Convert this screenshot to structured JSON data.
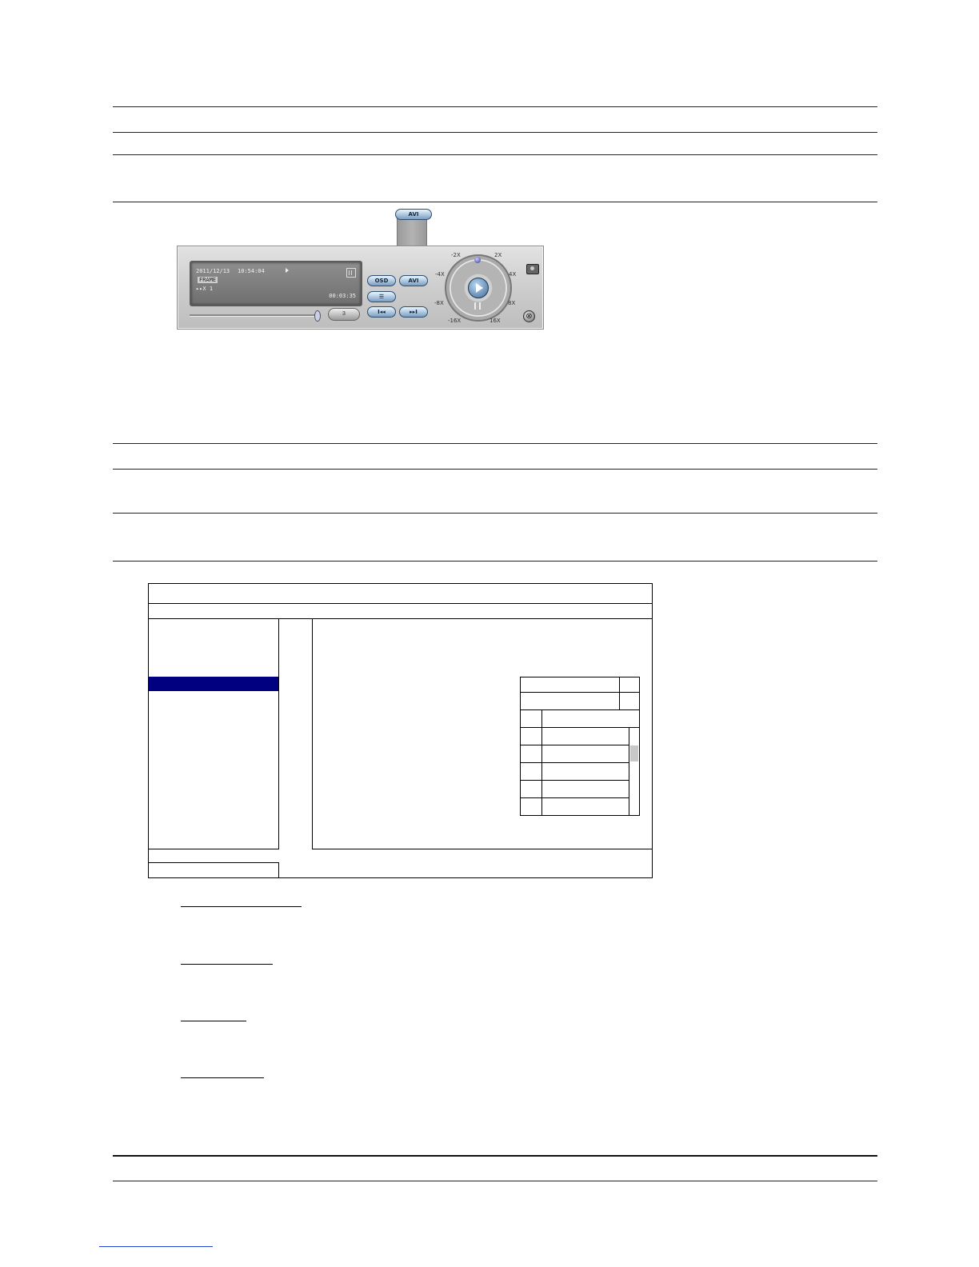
{
  "player": {
    "date": "2011/12/13",
    "time": "10:54:04",
    "mode_badge": "FRAME",
    "speed": "▸▸X 1",
    "elapsed": "00:03:35",
    "volume": "3",
    "btn_osd": "OSD",
    "btn_avi": "AVI",
    "btn_avi_popup": "AVI",
    "btn_prev": "I◂◂",
    "btn_next": "▸▸I",
    "dial_labels": {
      "neg2x": "-2X",
      "pos2x": "2X",
      "neg4x": "-4X",
      "pos4x": "4X",
      "neg8x": "-8X",
      "pos8x": "8X",
      "neg16x": "-16X",
      "pos16x": "16X"
    },
    "exit_glyph": "⊗"
  },
  "icons": {
    "camera": "camera-icon",
    "grid": "grid-icon",
    "play": "play-icon",
    "pause": "pause-icon",
    "stop": "stop-icon",
    "exit": "exit-icon"
  },
  "colors": {
    "menu_selection": "#000080",
    "button_blue": "#7b9ec1",
    "panel_gray": "#cfcfcf"
  }
}
